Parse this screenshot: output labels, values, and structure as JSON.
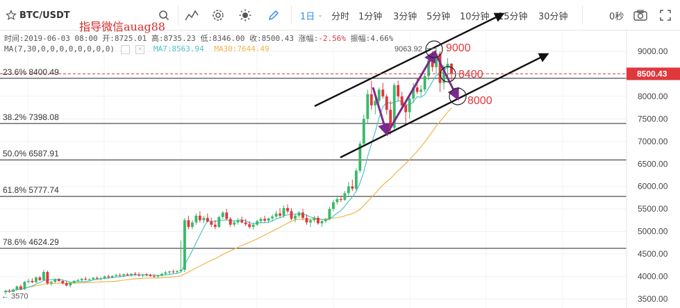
{
  "toolbar": {
    "symbol": "BTC/USDT",
    "interval_selected": "1日",
    "intervals": [
      "分时",
      "1分钟",
      "3分钟",
      "5分钟",
      "10分钟",
      "15分钟",
      "30分钟"
    ],
    "countdown": "0秒",
    "accent_color": "#2f8ce8"
  },
  "watermark": "指导微信auag88",
  "ohlc": {
    "time": "时间:2019-06-03 08:00",
    "open": "开:8725.01",
    "high": "高:8735.23",
    "low": "低:8346.00",
    "close": "收:8500.43",
    "change": "涨幅:",
    "change_value": "-2.56%",
    "amplitude": "振幅:4.66%"
  },
  "ma_legend": {
    "params": "MA(7,30,0,0,0,0,0,0,0,0)",
    "ma7": "MA7:8563.94",
    "ma30": "MA30:7644.49",
    "ma7_color": "#4fc3c3",
    "ma30_color": "#f0b44a"
  },
  "chart_data": {
    "type": "candlestick",
    "ylim": [
      3400,
      9400
    ],
    "y_ticks": [
      "3500.00",
      "4000.00",
      "4500.00",
      "5000.00",
      "5500.00",
      "6000.00",
      "6500.00",
      "7000.00",
      "7500.00",
      "8000.00",
      "8500.00",
      "9000.00"
    ],
    "y_tick_values": [
      3500,
      4000,
      4500,
      5000,
      5500,
      6000,
      6500,
      7000,
      7500,
      8000,
      8500,
      9000
    ],
    "last_price": "8500.43",
    "last_price_value": 8500.43,
    "high_marker": "9063.92",
    "high_marker_value": 9063.92,
    "low_marker": "3570",
    "low_marker_value": 3570,
    "fib_levels": [
      {
        "label": "23.6% 8400.49",
        "value": 8400.49
      },
      {
        "label": "38.2% 7398.08",
        "value": 7398.08
      },
      {
        "label": "50.0% 6587.91",
        "value": 6587.91
      },
      {
        "label": "61.8% 5777.74",
        "value": 5777.74
      },
      {
        "label": "78.6% 4624.29",
        "value": 4624.29
      }
    ],
    "annotations": [
      {
        "text": "9000",
        "value": 9000
      },
      {
        "text": "8400",
        "value": 8400
      },
      {
        "text": "8000",
        "value": 8000
      }
    ],
    "candles": [
      [
        3650,
        3700,
        3600,
        3680
      ],
      [
        3680,
        3720,
        3640,
        3660
      ],
      [
        3660,
        3730,
        3650,
        3710
      ],
      [
        3710,
        3800,
        3690,
        3780
      ],
      [
        3780,
        3820,
        3700,
        3720
      ],
      [
        3720,
        3900,
        3700,
        3880
      ],
      [
        3880,
        3950,
        3840,
        3900
      ],
      [
        3900,
        3960,
        3850,
        3870
      ],
      [
        3870,
        4000,
        3860,
        3980
      ],
      [
        3980,
        4010,
        3900,
        3920
      ],
      [
        3920,
        4150,
        3900,
        4100
      ],
      [
        4100,
        4130,
        3820,
        3850
      ],
      [
        3850,
        3900,
        3800,
        3880
      ],
      [
        3880,
        3960,
        3860,
        3940
      ],
      [
        3940,
        3960,
        3880,
        3900
      ],
      [
        3900,
        3920,
        3820,
        3850
      ],
      [
        3850,
        3900,
        3780,
        3800
      ],
      [
        3800,
        3880,
        3760,
        3860
      ],
      [
        3860,
        3920,
        3840,
        3900
      ],
      [
        3900,
        3950,
        3870,
        3920
      ],
      [
        3920,
        3970,
        3890,
        3950
      ],
      [
        3950,
        3990,
        3910,
        3930
      ],
      [
        3930,
        3960,
        3900,
        3940
      ],
      [
        3940,
        3990,
        3920,
        3970
      ],
      [
        3970,
        4000,
        3930,
        3950
      ],
      [
        3950,
        3990,
        3910,
        3960
      ],
      [
        3960,
        4020,
        3940,
        4000
      ],
      [
        4000,
        4040,
        3960,
        3980
      ],
      [
        3980,
        4030,
        3960,
        4010
      ],
      [
        4010,
        4060,
        3990,
        4030
      ],
      [
        4030,
        4070,
        4000,
        4020
      ],
      [
        4020,
        4060,
        3990,
        4050
      ],
      [
        4050,
        4080,
        4010,
        4030
      ],
      [
        4030,
        4070,
        4000,
        4060
      ],
      [
        4060,
        4100,
        4020,
        4040
      ],
      [
        4040,
        4090,
        4000,
        4020
      ],
      [
        4020,
        4060,
        3980,
        4040
      ],
      [
        4040,
        4080,
        4000,
        4030
      ],
      [
        4030,
        4060,
        3990,
        4010
      ],
      [
        4010,
        4050,
        3970,
        4000
      ],
      [
        4000,
        4040,
        3960,
        4020
      ],
      [
        4020,
        4080,
        4000,
        4060
      ],
      [
        4060,
        4120,
        4020,
        4090
      ],
      [
        4090,
        4130,
        4050,
        4110
      ],
      [
        4110,
        4150,
        4070,
        4100
      ],
      [
        4100,
        4140,
        4060,
        4120
      ],
      [
        4120,
        4800,
        4100,
        4150
      ],
      [
        4150,
        5300,
        4100,
        5250
      ],
      [
        5250,
        5350,
        5050,
        5100
      ],
      [
        5100,
        5250,
        5050,
        5200
      ],
      [
        5200,
        5400,
        5150,
        5350
      ],
      [
        5350,
        5450,
        5200,
        5250
      ],
      [
        5250,
        5350,
        5180,
        5300
      ],
      [
        5300,
        5400,
        5200,
        5220
      ],
      [
        5220,
        5300,
        5100,
        5150
      ],
      [
        5150,
        5250,
        5050,
        5100
      ],
      [
        5100,
        5350,
        5080,
        5320
      ],
      [
        5320,
        5450,
        5280,
        5420
      ],
      [
        5420,
        5500,
        5250,
        5280
      ],
      [
        5280,
        5320,
        5100,
        5150
      ],
      [
        5150,
        5250,
        5100,
        5200
      ],
      [
        5200,
        5300,
        5150,
        5250
      ],
      [
        5250,
        5330,
        5180,
        5200
      ],
      [
        5200,
        5280,
        5120,
        5160
      ],
      [
        5160,
        5230,
        5060,
        5100
      ],
      [
        5100,
        5200,
        5040,
        5150
      ],
      [
        5150,
        5260,
        5120,
        5230
      ],
      [
        5230,
        5320,
        5180,
        5280
      ],
      [
        5280,
        5350,
        5200,
        5240
      ],
      [
        5240,
        5310,
        5180,
        5290
      ],
      [
        5290,
        5380,
        5230,
        5330
      ],
      [
        5330,
        5460,
        5290,
        5400
      ],
      [
        5400,
        5520,
        5300,
        5350
      ],
      [
        5350,
        5580,
        5300,
        5520
      ],
      [
        5520,
        5600,
        5400,
        5450
      ],
      [
        5450,
        5520,
        5250,
        5280
      ],
      [
        5280,
        5400,
        5200,
        5350
      ],
      [
        5350,
        5450,
        5300,
        5420
      ],
      [
        5420,
        5500,
        5250,
        5300
      ],
      [
        5300,
        5380,
        5150,
        5200
      ],
      [
        5200,
        5280,
        5100,
        5250
      ],
      [
        5250,
        5350,
        5200,
        5300
      ],
      [
        5300,
        5350,
        5150,
        5180
      ],
      [
        5180,
        5250,
        5100,
        5230
      ],
      [
        5230,
        5300,
        5180,
        5270
      ],
      [
        5270,
        5550,
        5250,
        5500
      ],
      [
        5500,
        5700,
        5450,
        5650
      ],
      [
        5650,
        5800,
        5600,
        5720
      ],
      [
        5720,
        5800,
        5650,
        5700
      ],
      [
        5700,
        5900,
        5680,
        5850
      ],
      [
        5850,
        6100,
        5800,
        6000
      ],
      [
        6000,
        6150,
        5900,
        5950
      ],
      [
        5950,
        6400,
        5900,
        6350
      ],
      [
        6350,
        7000,
        6300,
        6950
      ],
      [
        6950,
        7600,
        6900,
        7500
      ],
      [
        7500,
        8150,
        7400,
        8050
      ],
      [
        8050,
        8350,
        7700,
        7800
      ],
      [
        7800,
        8050,
        7600,
        7900
      ],
      [
        7900,
        8200,
        7850,
        8150
      ],
      [
        8150,
        8300,
        7950,
        8000
      ],
      [
        8000,
        8050,
        7600,
        7700
      ],
      [
        7700,
        7900,
        7150,
        7300
      ],
      [
        7300,
        8300,
        7250,
        8250
      ],
      [
        8250,
        8350,
        7900,
        8000
      ],
      [
        8000,
        8100,
        7700,
        7800
      ],
      [
        7800,
        7900,
        7400,
        7650
      ],
      [
        7650,
        8000,
        7500,
        7950
      ],
      [
        7950,
        8300,
        7850,
        8200
      ],
      [
        8200,
        8400,
        8050,
        8100
      ],
      [
        8100,
        8250,
        8000,
        8150
      ],
      [
        8150,
        8500,
        8100,
        8450
      ],
      [
        8450,
        8850,
        8350,
        8800
      ],
      [
        8800,
        9000,
        8550,
        8650
      ],
      [
        8650,
        9063.92,
        8500,
        8950
      ],
      [
        8950,
        9000,
        8100,
        8300
      ],
      [
        8300,
        8700,
        8150,
        8650
      ],
      [
        8650,
        8850,
        8450,
        8725
      ],
      [
        8725.01,
        8735.23,
        8346.0,
        8500.43
      ]
    ]
  }
}
